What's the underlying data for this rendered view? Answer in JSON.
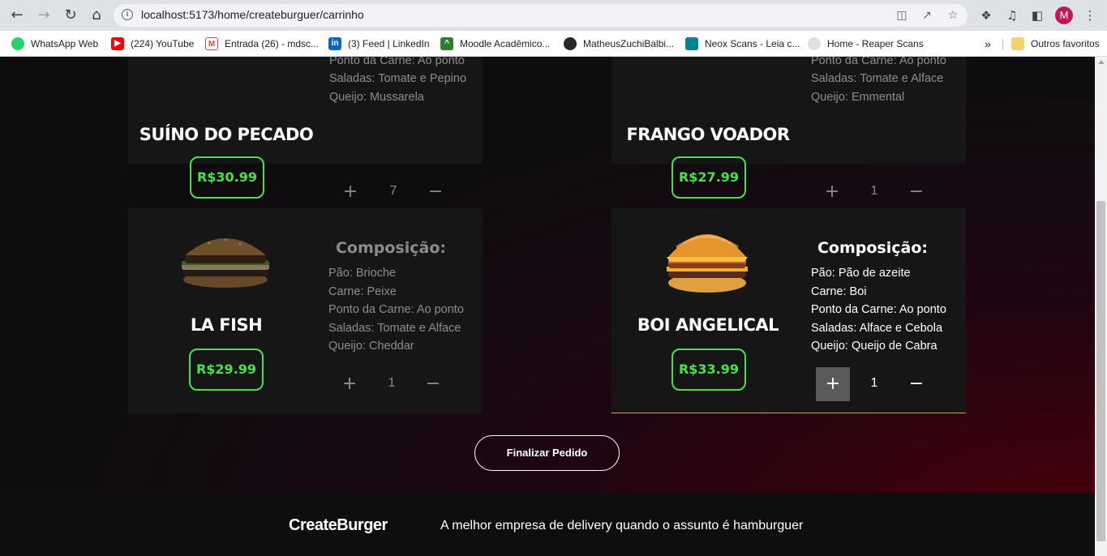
{
  "browser": {
    "url": "localhost:5173/home/createburguer/carrinho",
    "avatar_letter": "M",
    "bookmarks": [
      {
        "label": "WhatsApp Web",
        "icon": "whatsapp-icon",
        "color": "#25d366"
      },
      {
        "label": "(224) YouTube",
        "icon": "youtube-icon",
        "color": "#ff0000"
      },
      {
        "label": "Entrada (26) - mdsc...",
        "icon": "gmail-icon",
        "color": "#ea4335"
      },
      {
        "label": "(3) Feed | LinkedIn",
        "icon": "linkedin-icon",
        "color": "#0a66c2"
      },
      {
        "label": "Moodle Acadêmico...",
        "icon": "moodle-icon",
        "color": "#2e7d32"
      },
      {
        "label": "MatheusZuchiBalbi...",
        "icon": "github-icon",
        "color": "#24292e"
      },
      {
        "label": "Neox Scans - Leia c...",
        "icon": "neox-icon",
        "color": "#00838f"
      },
      {
        "label": "Home - Reaper Scans",
        "icon": "reaper-icon",
        "color": "#bdbdbd"
      }
    ],
    "overflow": "»",
    "other_favorites": "Outros favoritos"
  },
  "cart": {
    "composition_title": "Composição:",
    "items": [
      {
        "name": "SUÍNO DO PECADO",
        "price": "R$30.99",
        "lines": [
          "Ponto da Carne: Ao ponto",
          "Saladas: Tomate e Pepino",
          "Queijo: Mussarela"
        ],
        "quantity": "7"
      },
      {
        "name": "FRANGO VOADOR",
        "price": "R$27.99",
        "lines": [
          "Ponto da Carne: Ao ponto",
          "Saladas: Tomate e Alface",
          "Queijo: Emmental"
        ],
        "quantity": "1"
      },
      {
        "name": "LA FISH",
        "price": "R$29.99",
        "lines": [
          "Pão: Brioche",
          "Carne: Peixe",
          "Ponto da Carne: Ao ponto",
          "Saladas: Tomate e Alface",
          "Queijo: Cheddar"
        ],
        "quantity": "1"
      },
      {
        "name": "BOI ANGELICAL",
        "price": "R$33.99",
        "lines": [
          "Pão: Pão de azeite",
          "Carne: Boi",
          "Ponto da Carne: Ao ponto",
          "Saladas: Alface e Cebola",
          "Queijo: Queijo de Cabra"
        ],
        "quantity": "1"
      }
    ],
    "plus": "+",
    "minus": "−",
    "finalize_label": "Finalizar Pedido"
  },
  "footer": {
    "brand": "CreateBurger",
    "tagline": "A melhor empresa de delivery quando o assunto é hamburguer"
  },
  "colors": {
    "accent_green": "#4ae24a",
    "card_bg": "#161616",
    "highlight_border": "#c9a24a"
  }
}
